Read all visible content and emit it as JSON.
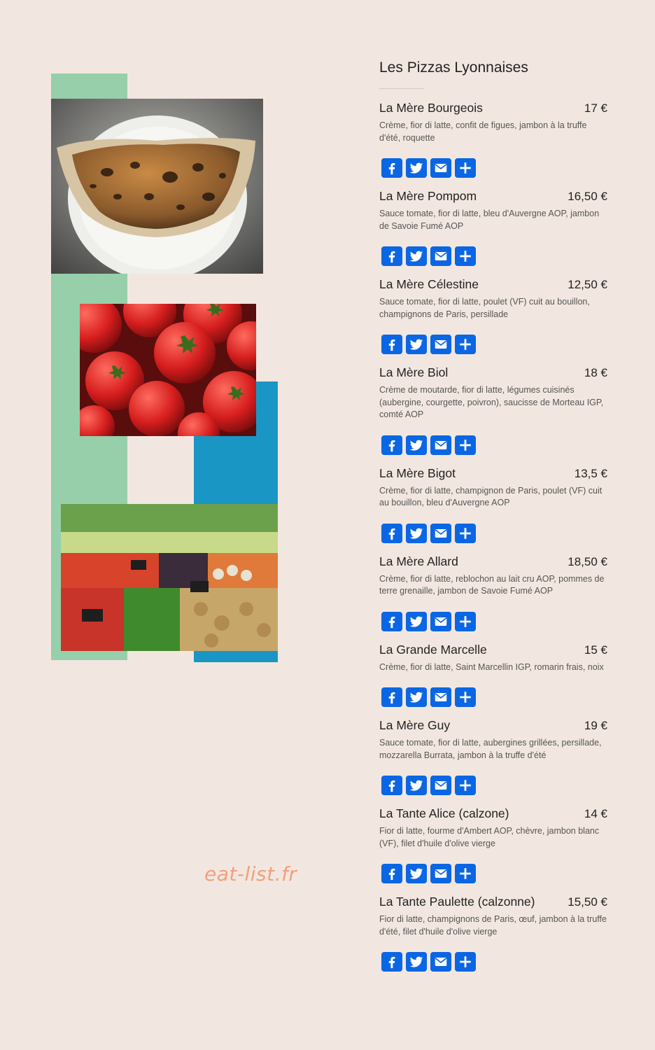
{
  "watermark": "eat-list.fr",
  "colors": {
    "background": "#f2e7e0",
    "green": "#96cfaa",
    "blue": "#1a96c4",
    "share_blue": "#0b66e4",
    "watermark": "#f1a07e"
  },
  "menu": {
    "title": "Les Pizzas Lyonnaises",
    "share_icons": [
      "facebook-icon",
      "twitter-icon",
      "email-icon",
      "plus-icon"
    ],
    "items": [
      {
        "name": "La Mère Bourgeois",
        "price": "17 €",
        "description": "Crème, fior di latte, confit de figues, jambon à la truffe d'été, roquette"
      },
      {
        "name": "La Mère Pompom",
        "price": "16,50 €",
        "description": "Sauce tomate, fior di latte, bleu d'Auvergne AOP, jambon de Savoie Fumé AOP"
      },
      {
        "name": "La Mère Célestine",
        "price": "12,50 €",
        "description": "Sauce tomate, fior di latte, poulet (VF) cuit au bouillon, champignons de Paris, persillade"
      },
      {
        "name": "La Mère Biol",
        "price": "18 €",
        "description": "Crème de moutarde, fior di latte, légumes cuisinés (aubergine, courgette, poivron), saucisse de Morteau IGP, comté AOP"
      },
      {
        "name": "La Mère Bigot",
        "price": "13,5 €",
        "description": "Crème, fior di latte, champignon de Paris, poulet (VF) cuit au bouillon, bleu d'Auvergne AOP"
      },
      {
        "name": "La Mère Allard",
        "price": "18,50 €",
        "description": "Crème, fior di latte, reblochon au lait cru AOP, pommes de terre grenaille, jambon de Savoie Fumé AOP"
      },
      {
        "name": "La Grande Marcelle",
        "price": "15 €",
        "description": "Crème, fior di latte, Saint Marcellin IGP, romarin frais, noix"
      },
      {
        "name": "La Mère Guy",
        "price": "19 €",
        "description": "Sauce tomate, fior di latte, aubergines grillées, persillade, mozzarella Burrata, jambon à la truffe d'été"
      },
      {
        "name": "La Tante Alice (calzone)",
        "price": "14 €",
        "description": "Fior di latte, fourme d'Ambert AOP, chèvre, jambon blanc (VF), filet d'huile d'olive vierge"
      },
      {
        "name": "La Tante Paulette (calzonne)",
        "price": "15,50 €",
        "description": "Fior di latte, champignons de Paris, œuf, jambon à la truffe d'été, filet d'huile d'olive vierge"
      }
    ]
  }
}
